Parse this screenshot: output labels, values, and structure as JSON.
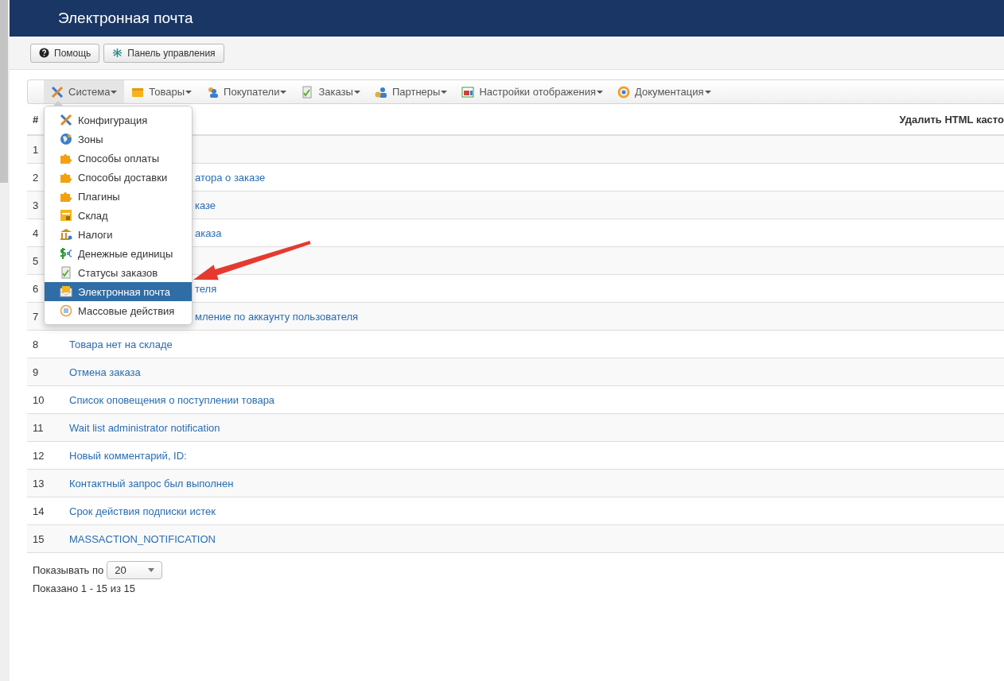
{
  "header": {
    "title": "Электронная почта"
  },
  "toolbar": [
    {
      "label": "Помощь"
    },
    {
      "label": "Панель управления"
    }
  ],
  "menu": [
    {
      "label": "Система",
      "selected": true
    },
    {
      "label": "Товары",
      "selected": false
    },
    {
      "label": "Покупатели",
      "selected": false
    },
    {
      "label": "Заказы",
      "selected": false
    },
    {
      "label": "Партнеры",
      "selected": false
    },
    {
      "label": "Настройки отображения",
      "selected": false
    },
    {
      "label": "Документация",
      "selected": false
    }
  ],
  "dropdown": [
    {
      "label": "Конфигурация",
      "selected": false
    },
    {
      "label": "Зоны",
      "selected": false
    },
    {
      "label": "Способы оплаты",
      "selected": false
    },
    {
      "label": "Способы доставки",
      "selected": false
    },
    {
      "label": "Плагины",
      "selected": false
    },
    {
      "label": "Склад",
      "selected": false
    },
    {
      "label": "Налоги",
      "selected": false
    },
    {
      "label": "Денежные единицы",
      "selected": false
    },
    {
      "label": "Статусы заказов",
      "selected": false
    },
    {
      "label": "Электронная почта",
      "selected": true
    },
    {
      "label": "Массовые действия",
      "selected": false
    }
  ],
  "table": {
    "column_headers": [
      "#",
      "Удалить HTML касто"
    ],
    "rows": [
      {
        "number": "1"
      },
      {
        "number": "2",
        "name_visible_end": "атора о заказе"
      },
      {
        "number": "3",
        "name_visible_end": "казе"
      },
      {
        "number": "4",
        "name_visible_end": "аказа"
      },
      {
        "number": "5"
      },
      {
        "number": "6",
        "name_visible_end": "теля"
      },
      {
        "number": "7",
        "name_visible_end": "мление по аккаунту пользователя"
      },
      {
        "number": "8",
        "name": "Товара нет на складе"
      },
      {
        "number": "9",
        "name": "Отмена заказа"
      },
      {
        "number": "10",
        "name": "Список оповещения о поступлении товара"
      },
      {
        "number": "11",
        "name": "Wait list administrator notification"
      },
      {
        "number": "12",
        "name": "Новый комментарий, ID:"
      },
      {
        "number": "13",
        "name": "Контактный запрос был выполнен"
      },
      {
        "number": "14",
        "name": "Срок действия подписки истек"
      },
      {
        "number": "15",
        "name": "MASSACTION_NOTIFICATION"
      }
    ]
  },
  "pagination": {
    "label": "Показывать по",
    "page_size": "20",
    "summary": "Показано 1 - 15 из 15"
  }
}
